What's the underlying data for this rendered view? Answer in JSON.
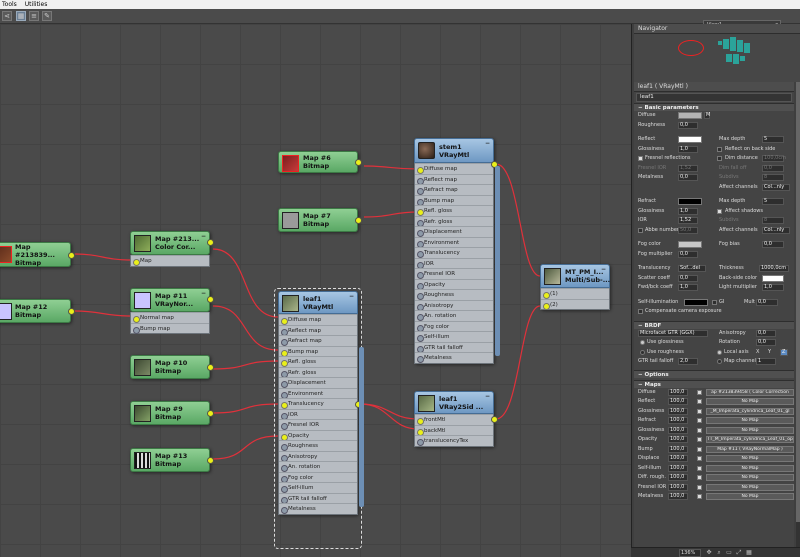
{
  "menu": [
    "Tools",
    "Utilities"
  ],
  "toolbar": {
    "view_select": "View1"
  },
  "nodes": {
    "map_top_red": {
      "line1": "Map #6",
      "line2": "Bitmap"
    },
    "map_left_cc": {
      "line1": "Map #213839...",
      "line2": "Bitmap"
    },
    "map_213": {
      "line1": "Map #213...",
      "line2": "Color Cor...",
      "slots": [
        "Map"
      ]
    },
    "map_12": {
      "line1": "Map #12",
      "line2": "Bitmap"
    },
    "map_11": {
      "line1": "Map #11",
      "line2": "VRayNor...",
      "slots": [
        "Normal map",
        "Bump map"
      ]
    },
    "map_10": {
      "line1": "Map #10",
      "line2": "Bitmap"
    },
    "map_9": {
      "line1": "Map #9",
      "line2": "Bitmap"
    },
    "map_13": {
      "line1": "Map #13",
      "line2": "Bitmap"
    },
    "map_7": {
      "line1": "Map #7",
      "line2": "Bitmap"
    },
    "stem1": {
      "line1": "stem1",
      "line2": "VRayMtl",
      "slots": [
        "Diffuse map",
        "Reflect map",
        "Refract map",
        "Bump map",
        "Refl. gloss",
        "Refr. gloss",
        "Displacement",
        "Environment",
        "Translucency",
        "IOR",
        "Fresnel IOR",
        "Opacity",
        "Roughness",
        "Anisotropy",
        "An. rotation",
        "Fog color",
        "Self-illum",
        "GTR tail falloff",
        "Metalness"
      ]
    },
    "leaf1_mtl": {
      "line1": "leaf1",
      "line2": "VRayMtl",
      "slots": [
        "Diffuse map",
        "Reflect map",
        "Refract map",
        "Bump map",
        "Refl. gloss",
        "Refr. gloss",
        "Displacement",
        "Environment",
        "Translucency",
        "IOR",
        "Fresnel IOR",
        "Opacity",
        "Roughness",
        "Anisotropy",
        "An. rotation",
        "Fog color",
        "Self-illum",
        "GTR tail falloff",
        "Metalness"
      ]
    },
    "leaf1_2sid": {
      "line1": "leaf1",
      "line2": "VRay2Sid ...",
      "slots": [
        "frontMtl",
        "backMtl",
        "translucencyTex"
      ]
    },
    "mt_pm": {
      "line1": "MT_PM_I...",
      "line2": "Multi/Sub-...",
      "slots": [
        "(1)",
        "(2)"
      ]
    }
  },
  "panel": {
    "navigator_title": "Navigator",
    "props_title": "leaf1  ( VRayMtl )",
    "material_name": "leaf1",
    "basic_title": "Basic parameters",
    "diffuse_label": "Diffuse",
    "roughness_label": "Roughness",
    "roughness_value": "0,0",
    "reflect_label": "Reflect",
    "glossiness_label": "Glossiness",
    "glossiness_value": "1,0",
    "fresnel_label": "Fresnel reflections",
    "fresnel_ior_label": "Fresnel IOR",
    "fresnel_ior_value": "1,52",
    "metalness_label": "Metalness",
    "metalness_value": "0,0",
    "max_depth_label": "Max depth",
    "max_depth_value": "5",
    "reflect_backside_label": "Reflect on back side",
    "dim_distance_label": "Dim distance",
    "dim_distance_value": "100,0cm",
    "dim_falloff_label": "Dim fall off",
    "dim_falloff_value": "0,0",
    "subdivs_label": "Subdivs",
    "subdivs_value": "8",
    "affect_channels_label": "Affect channels",
    "affect_channels_value": "Col...nly",
    "refract_label": "Refract",
    "refr_glossiness_value": "1,0",
    "ior_label": "IOR",
    "ior_value": "1,52",
    "abbe_label": "Abbe number",
    "abbe_value": "50,0",
    "refr_max_depth_value": "5",
    "affect_shadows_label": "Affect shadows",
    "refr_subdivs_value": "8",
    "refr_affect_channels_value": "Col...nly",
    "fog_color_label": "Fog color",
    "fog_bias_label": "Fog bias",
    "fog_bias_value": "0,0",
    "fog_mult_label": "Fog multiplier",
    "fog_mult_value": "0,0",
    "translucency_label": "Translucency",
    "translucency_value": "Sof...del",
    "thickness_label": "Thickness",
    "thickness_value": "1000,0cm",
    "scatter_label": "Scatter coeff",
    "scatter_value": "0,0",
    "backside_color_label": "Back-side color",
    "fwdbck_label": "Fwd/bck coeff",
    "fwdbck_value": "1,0",
    "light_mult_label": "Light multiplier",
    "light_mult_value": "1,0",
    "selfillum_label": "Self-illumination",
    "gi_label": "GI",
    "mult_label": "Mult",
    "mult_value": "0,0",
    "comp_camera_label": "Compensate camera exposure",
    "brdf_title": "BRDF",
    "brdf_type": "Microfacet GTR (GGX)",
    "use_glossiness_label": "Use glossiness",
    "use_roughness_label": "Use roughness",
    "anisotropy_label": "Anisotropy",
    "anisotropy_value": "0,0",
    "rotation_label": "Rotation",
    "rotation_value": "0,0",
    "local_axis_label": "Local axis",
    "axis_x": "X",
    "axis_y": "Y",
    "axis_z": "Z",
    "map_channel_label": "Map channel",
    "map_channel_value": "1",
    "gtr_label": "GTR tail falloff",
    "gtr_value": "2,0",
    "options_title": "Options",
    "maps_title": "Maps",
    "maps": [
      {
        "label": "Diffuse",
        "amount": "100,0",
        "map": "ap #213839458  ( Color Correction"
      },
      {
        "label": "Reflect",
        "amount": "100,0",
        "map": "No Map"
      },
      {
        "label": "Glossiness",
        "amount": "100,0",
        "map": "_M_Imperata_cylindrica_Leaf_01_gl"
      },
      {
        "label": "Refract",
        "amount": "100,0",
        "map": "No Map"
      },
      {
        "label": "Glossiness",
        "amount": "100,0",
        "map": "No Map"
      },
      {
        "label": "Opacity",
        "amount": "100,0",
        "map": "TT_M_Imperata_cylindrica_Leaf_01_op"
      },
      {
        "label": "Bump",
        "amount": "100,0",
        "map": "Map #11  ( VRayNormalMap )"
      },
      {
        "label": "Displace",
        "amount": "100,0",
        "map": "No Map"
      },
      {
        "label": "Self-illum",
        "amount": "100,0",
        "map": "No Map"
      },
      {
        "label": "Diff. rough.",
        "amount": "100,0",
        "map": "No Map"
      },
      {
        "label": "Fresnel IOR",
        "amount": "100,0",
        "map": "No Map"
      },
      {
        "label": "Metalness",
        "amount": "100,0",
        "map": "No Map"
      }
    ],
    "zoom": "136%"
  },
  "colors": {
    "wire": "#e0313b",
    "node_green": "#6dbb78",
    "node_blue": "#86aed6",
    "socket": "#eaf01a"
  }
}
